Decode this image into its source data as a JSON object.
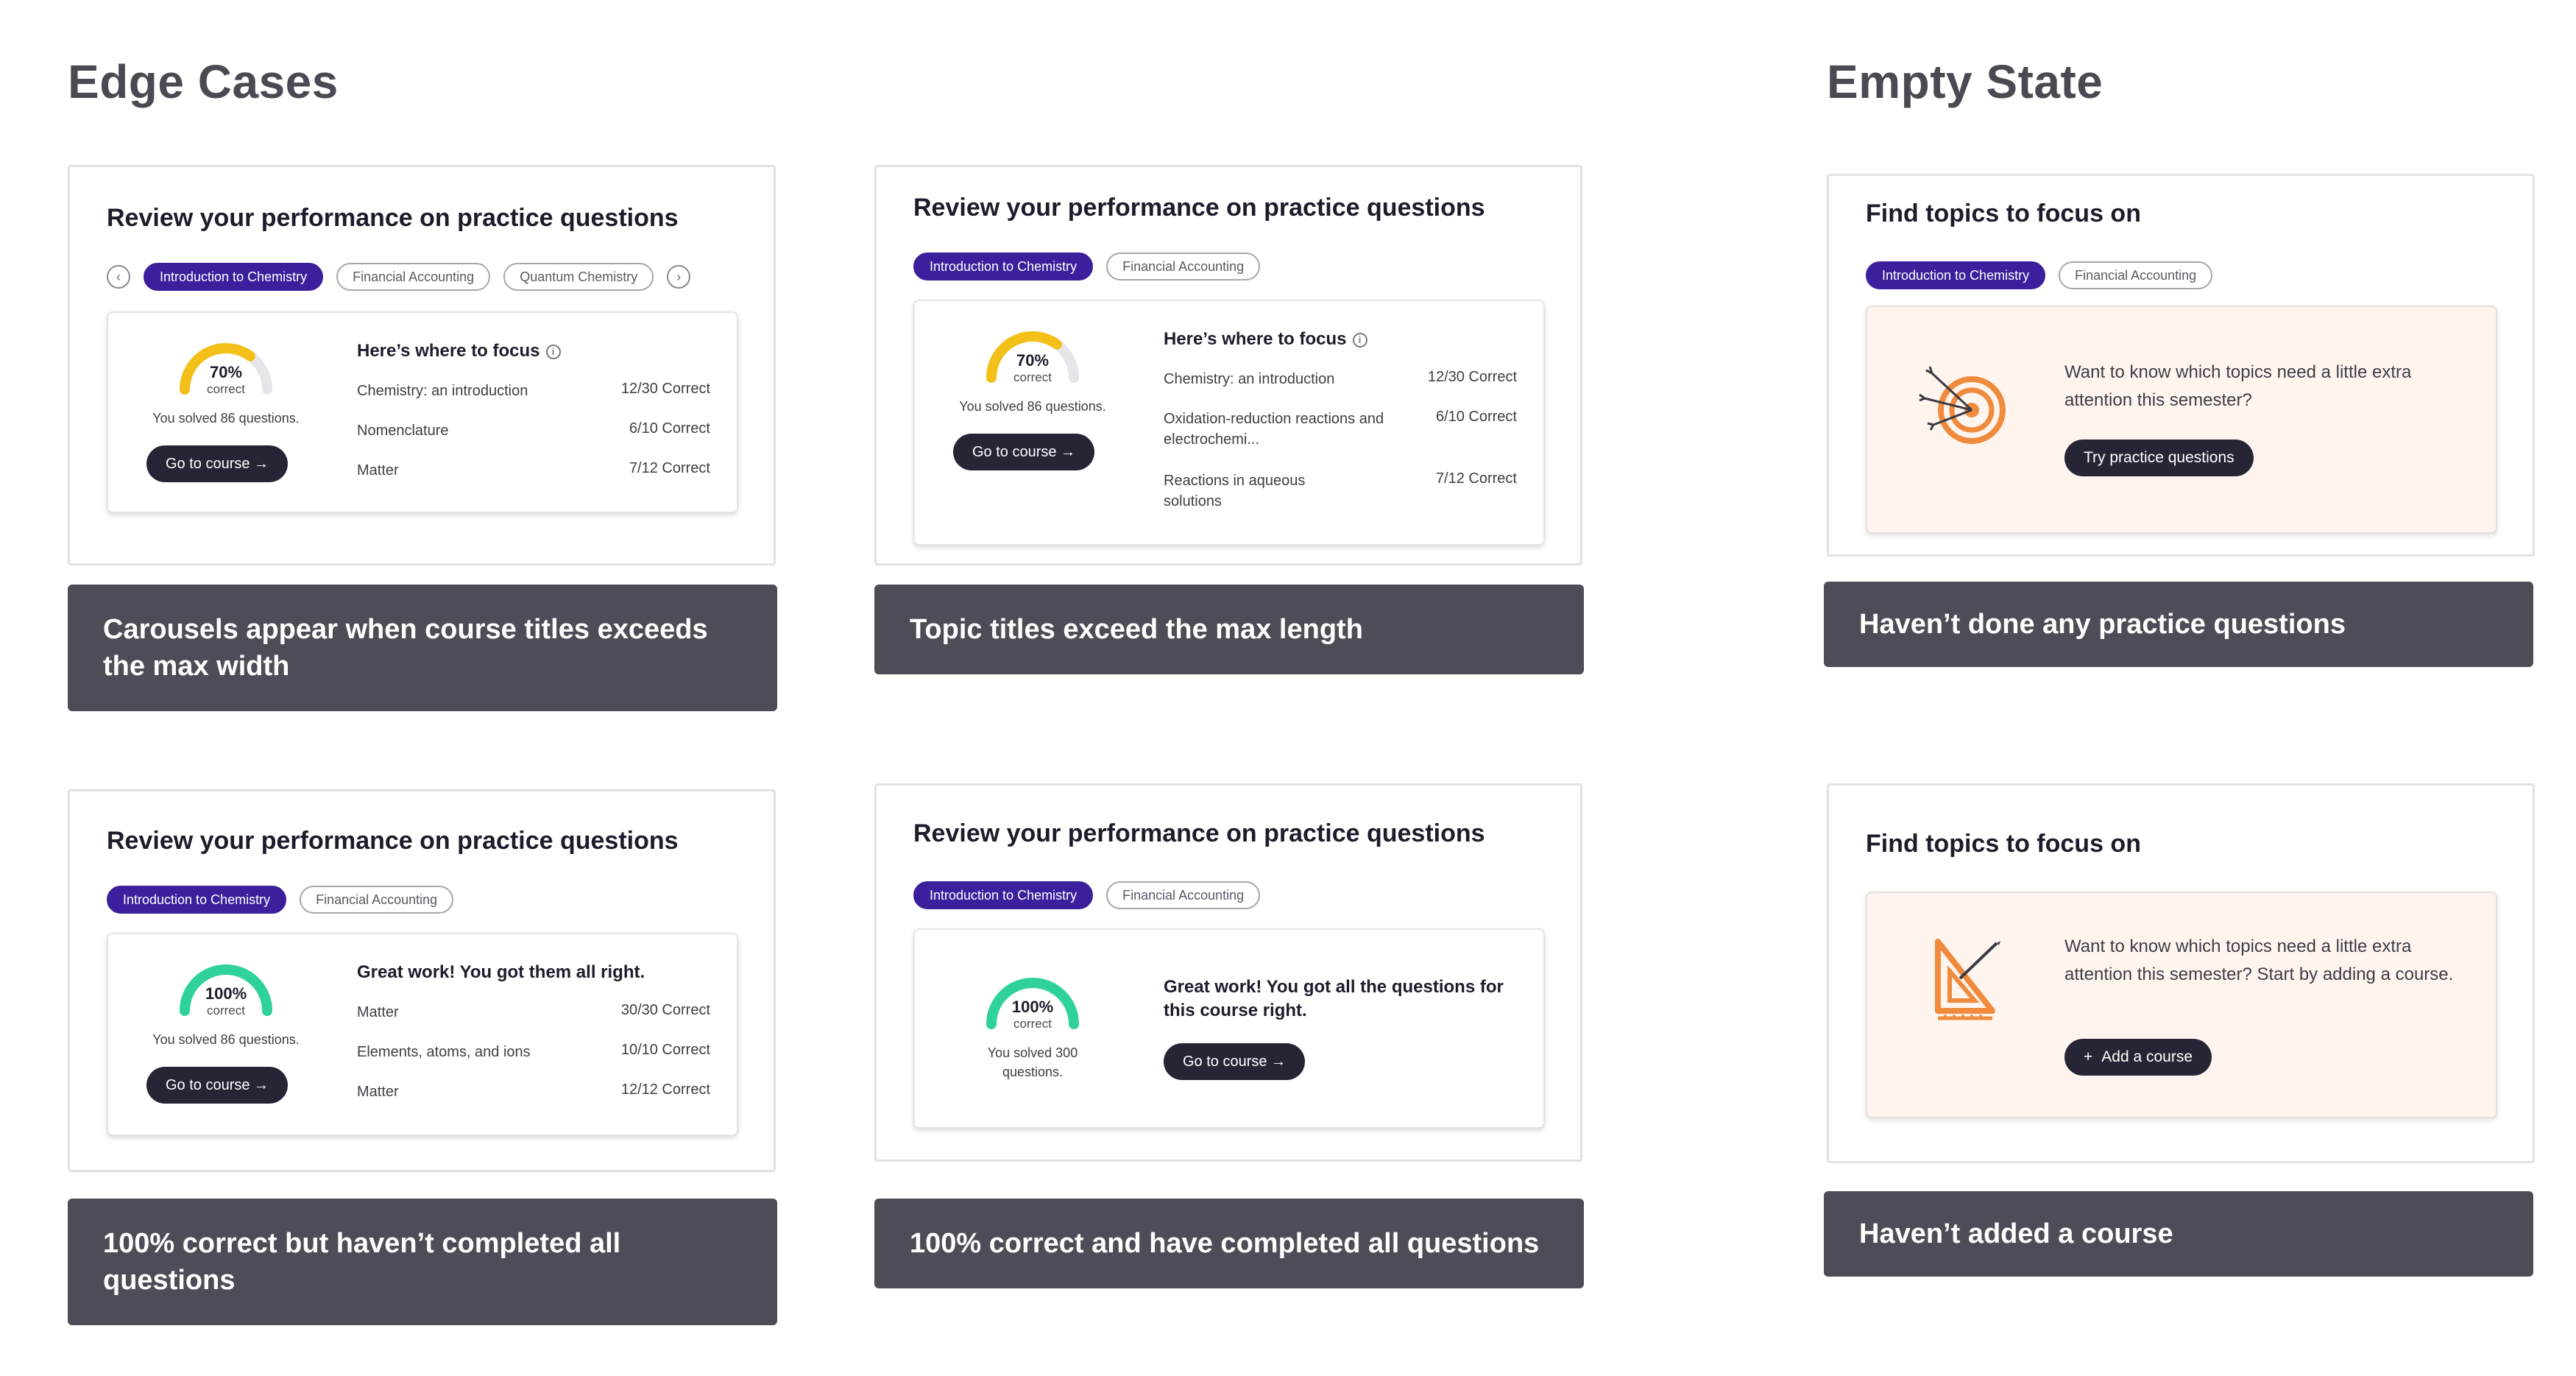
{
  "sections": {
    "edge_cases": "Edge Cases",
    "empty_state": "Empty State"
  },
  "colors": {
    "brand_purple": "#3b1f9c",
    "gauge_yellow": "#f2c018",
    "gauge_green": "#2fd39a",
    "caption_bg": "#4e4d57",
    "peach_bg": "#fff5ee",
    "icon_orange": "#f08a3c"
  },
  "common": {
    "review_title": "Review your performance on practice questions",
    "find_title": "Find topics to focus on",
    "course_intro": "Introduction to Chemistry",
    "course_fin": "Financial Accounting",
    "course_quantum": "Quantum Chemistry",
    "go_to_course": "Go to course →",
    "correct_label": "correct",
    "focus_head": "Here’s where to focus",
    "info_icon": "i"
  },
  "card1": {
    "gauge_pct": "70%",
    "gauge_value": 0.7,
    "solved": "You solved 86 questions.",
    "rows": [
      {
        "topic": "Chemistry: an introduction",
        "score": "12/30 Correct"
      },
      {
        "topic": "Nomenclature",
        "score": "6/10 Correct"
      },
      {
        "topic": "Matter",
        "score": "7/12 Correct"
      }
    ],
    "caption": "Carousels appear when course titles exceeds the max width"
  },
  "card2": {
    "gauge_pct": "70%",
    "gauge_value": 0.7,
    "solved": "You solved 86 questions.",
    "rows": [
      {
        "topic": "Chemistry: an introduction",
        "score": "12/30 Correct"
      },
      {
        "topic": "Oxidation-reduction reactions and electrochemi...",
        "score": "6/10 Correct"
      },
      {
        "topic": "Reactions in aqueous solutions",
        "score": "7/12 Correct"
      }
    ],
    "caption": "Topic titles exceed the max length"
  },
  "card3": {
    "gauge_pct": "100%",
    "gauge_value": 1.0,
    "solved": "You solved 86 questions.",
    "head": "Great work! You got them all right.",
    "rows": [
      {
        "topic": "Matter",
        "score": "30/30 Correct"
      },
      {
        "topic": "Elements, atoms, and ions",
        "score": "10/10 Correct"
      },
      {
        "topic": "Matter",
        "score": "12/12 Correct"
      }
    ],
    "caption": "100% correct but haven’t completed all questions"
  },
  "card4": {
    "gauge_pct": "100%",
    "gauge_value": 1.0,
    "solved": "You solved 300 questions.",
    "head": "Great work! You got all the questions for this course right.",
    "caption": "100% correct and have completed all questions"
  },
  "empty1": {
    "text": "Want to know which topics need a little extra attention this semester?",
    "button": "Try practice questions",
    "icon": "target-icon",
    "caption": "Haven’t done any practice questions"
  },
  "empty2": {
    "text": "Want to know which topics need a little extra attention this semester? Start by adding a course.",
    "button": "Add a course",
    "plus": "+",
    "icon": "set-square-icon",
    "caption": "Haven’t added a course"
  }
}
